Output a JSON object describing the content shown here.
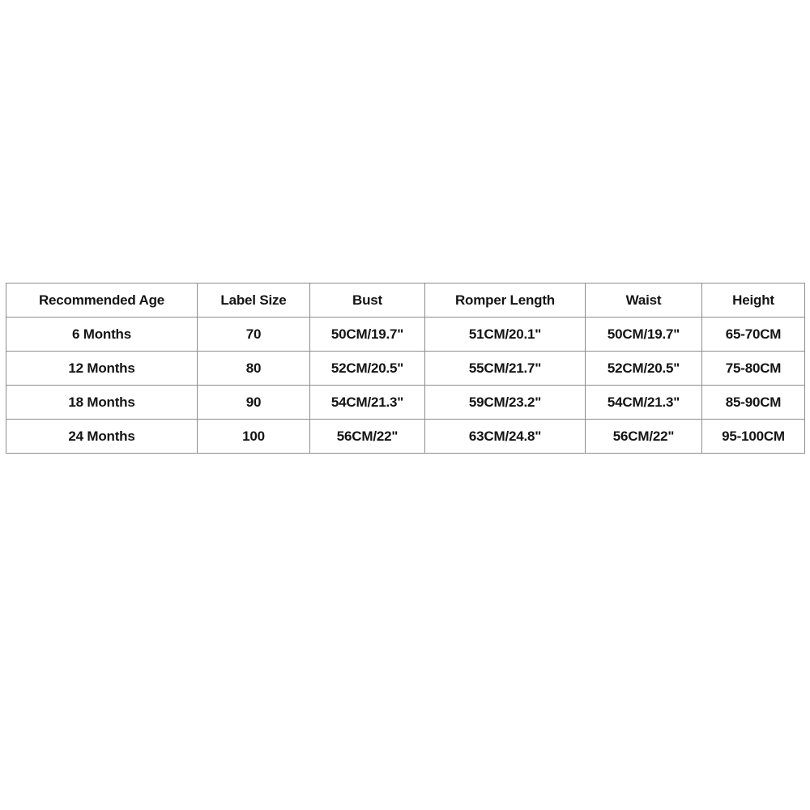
{
  "page": {
    "background_color": "#ffffff",
    "text_color": "#141414",
    "border_color": "#8d8d8d"
  },
  "size_chart": {
    "columns": [
      "Recommended Age",
      "Label Size",
      "Bust",
      "Romper Length",
      "Waist",
      "Height"
    ],
    "rows": [
      {
        "recommended_age": "6 Months",
        "label_size": "70",
        "bust": "50CM/19.7\"",
        "romper_length": "51CM/20.1\"",
        "waist": "50CM/19.7\"",
        "height": "65-70CM"
      },
      {
        "recommended_age": "12 Months",
        "label_size": "80",
        "bust": "52CM/20.5\"",
        "romper_length": "55CM/21.7\"",
        "waist": "52CM/20.5\"",
        "height": "75-80CM"
      },
      {
        "recommended_age": "18 Months",
        "label_size": "90",
        "bust": "54CM/21.3\"",
        "romper_length": "59CM/23.2\"",
        "waist": "54CM/21.3\"",
        "height": "85-90CM"
      },
      {
        "recommended_age": "24 Months",
        "label_size": "100",
        "bust": "56CM/22\"",
        "romper_length": "63CM/24.8\"",
        "waist": "56CM/22\"",
        "height": "95-100CM"
      }
    ]
  }
}
